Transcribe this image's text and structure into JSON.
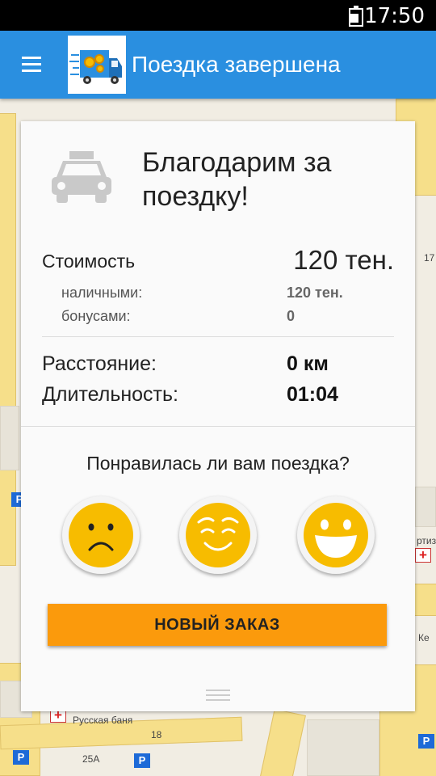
{
  "status_bar": {
    "time": "17:50"
  },
  "app_bar": {
    "title": "Поездка завершена",
    "menu_icon": "hamburger-icon",
    "logo_icon": "delivery-truck-logo"
  },
  "card": {
    "thanks": "Благодарим за поездку!",
    "cost": {
      "label": "Стоимость",
      "value": "120 тен.",
      "cash_label": "наличными:",
      "cash_value": "120 тен.",
      "bonus_label": "бонусами:",
      "bonus_value": "0"
    },
    "distance": {
      "label": "Расстояние:",
      "value": "0 км"
    },
    "duration": {
      "label": "Длительность:",
      "value": "01:04"
    },
    "rating": {
      "question": "Понравилась ли вам поездка?",
      "options": [
        "sad-face-icon",
        "smiling-face-icon",
        "grinning-face-icon"
      ]
    },
    "new_order_button": "НОВЫЙ ЗАКАЗ"
  },
  "map": {
    "labels": {
      "banya": "Русская баня",
      "num_18": "18",
      "num_25a": "25А",
      "ke": "Ке",
      "rtiz": "ртиз",
      "num_17": "17"
    }
  },
  "colors": {
    "app_bar": "#2a8fe0",
    "button": "#fb9a0c",
    "smiley": "#f7bc00"
  }
}
